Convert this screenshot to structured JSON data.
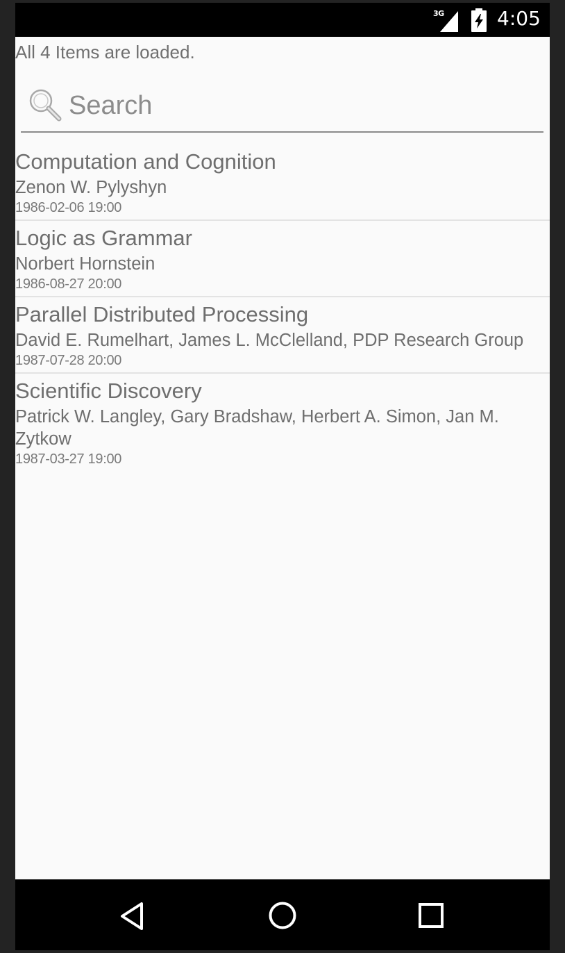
{
  "status_bar": {
    "network": "3G",
    "time": "4:05",
    "icons": [
      "signal-icon",
      "battery-charging-icon"
    ]
  },
  "load_status": "All 4 Items are loaded.",
  "search": {
    "placeholder": "Search",
    "value": "",
    "icon": "search-icon"
  },
  "items": [
    {
      "title": "Computation and Cognition",
      "authors": "Zenon W. Pylyshyn",
      "date": "1986-02-06 19:00"
    },
    {
      "title": "Logic as Grammar",
      "authors": "Norbert Hornstein",
      "date": "1986-08-27 20:00"
    },
    {
      "title": "Parallel Distributed Processing",
      "authors": "David E. Rumelhart, James L. McClelland, PDP Research Group",
      "date": "1987-07-28 20:00"
    },
    {
      "title": "Scientific Discovery",
      "authors": "Patrick W. Langley, Gary Bradshaw, Herbert A. Simon, Jan M. Zytkow",
      "date": "1987-03-27 19:00"
    }
  ],
  "nav_bar": {
    "icons": [
      "back-icon",
      "home-icon",
      "recents-icon"
    ]
  }
}
